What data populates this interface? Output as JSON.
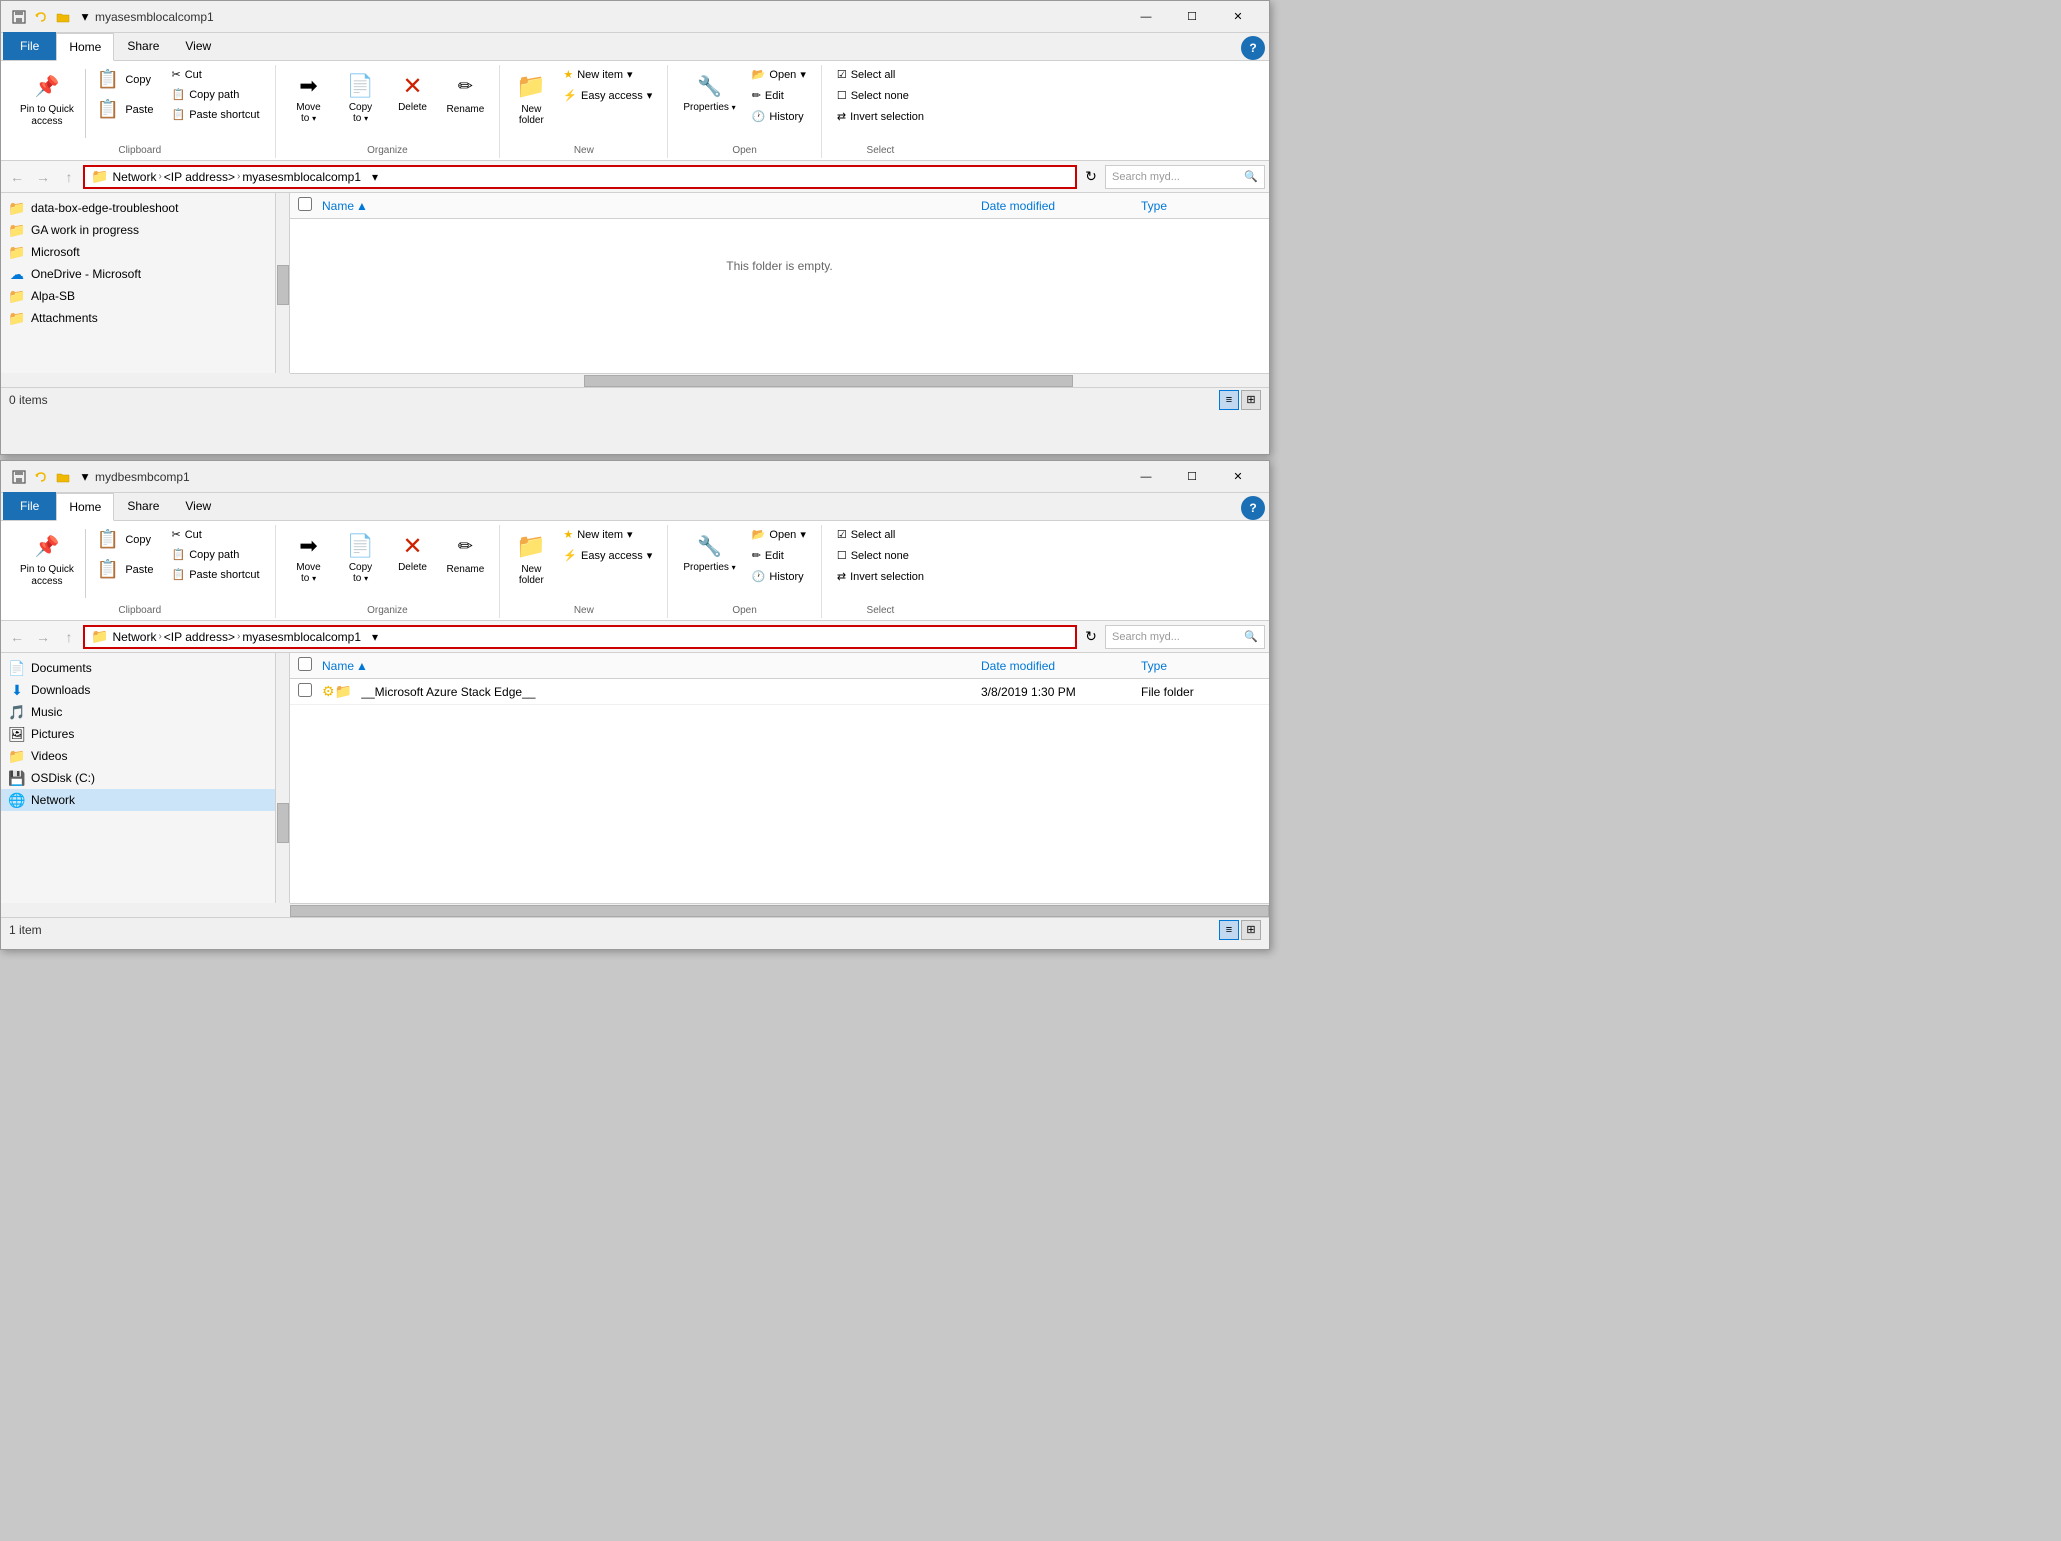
{
  "window1": {
    "title": "myasesmblocalcomp1",
    "tabs": {
      "file": "File",
      "home": "Home",
      "share": "Share",
      "view": "View"
    },
    "ribbon": {
      "clipboard": {
        "label": "Clipboard",
        "pin_to_quick_access": "Pin to Quick\naccess",
        "copy": "Copy",
        "paste": "Paste",
        "cut": "Cut",
        "copy_path": "Copy path",
        "paste_shortcut": "Paste shortcut"
      },
      "organize": {
        "label": "Organize",
        "move_to": "Move\nto",
        "copy_to": "Copy\nto",
        "delete": "Delete",
        "rename": "Rename"
      },
      "new": {
        "label": "New",
        "new_folder": "New\nfolder",
        "new_item": "New item",
        "easy_access": "Easy access"
      },
      "open": {
        "label": "Open",
        "properties": "Properties",
        "open": "Open",
        "edit": "Edit",
        "history": "History"
      },
      "select": {
        "label": "Select",
        "select_all": "Select all",
        "select_none": "Select none",
        "invert_selection": "Invert selection"
      }
    },
    "address": {
      "path": "Network > <IP address> > myasesmblocalcomp1",
      "network": "Network",
      "ip": "<IP address>",
      "share": "myasesmblocalcomp1",
      "search_placeholder": "Search myd..."
    },
    "nav_items": [
      {
        "label": "data-box-edge-troubleshoot",
        "type": "folder_yellow"
      },
      {
        "label": "GA work in progress",
        "type": "folder_yellow"
      },
      {
        "label": "Microsoft",
        "type": "folder_blue"
      },
      {
        "label": "OneDrive - Microsoft",
        "type": "onedrive"
      },
      {
        "label": "Alpa-SB",
        "type": "folder_yellow"
      },
      {
        "label": "Attachments",
        "type": "folder_yellow"
      }
    ],
    "file_list": {
      "columns": {
        "name": "Name",
        "date_modified": "Date modified",
        "type": "Type"
      },
      "empty_message": "This folder is empty.",
      "items": []
    },
    "status": "0 items"
  },
  "window2": {
    "title": "mydbesmbcomp1",
    "tabs": {
      "file": "File",
      "home": "Home",
      "share": "Share",
      "view": "View"
    },
    "ribbon": {
      "clipboard": {
        "label": "Clipboard",
        "pin_to_quick_access": "Pin to Quick\naccess",
        "copy": "Copy",
        "paste": "Paste",
        "cut": "Cut",
        "copy_path": "Copy path",
        "paste_shortcut": "Paste shortcut"
      },
      "organize": {
        "label": "Organize",
        "move_to": "Move\nto",
        "copy_to": "Copy\nto",
        "delete": "Delete",
        "rename": "Rename"
      },
      "new": {
        "label": "New",
        "new_folder": "New\nfolder",
        "new_item": "New item",
        "easy_access": "Easy access"
      },
      "open": {
        "label": "Open",
        "properties": "Properties",
        "open": "Open",
        "edit": "Edit",
        "history": "History"
      },
      "select": {
        "label": "Select",
        "select_all": "Select all",
        "select_none": "Select none",
        "invert_selection": "Invert selection"
      }
    },
    "address": {
      "path": "Network > <IP address> > myasesmblocalcomp1",
      "network": "Network",
      "ip": "<IP address>",
      "share": "myasesmblocalcomp1",
      "search_placeholder": "Search myd..."
    },
    "nav_items": [
      {
        "label": "Documents",
        "type": "doc"
      },
      {
        "label": "Downloads",
        "type": "download"
      },
      {
        "label": "Music",
        "type": "music"
      },
      {
        "label": "Pictures",
        "type": "pictures"
      },
      {
        "label": "Videos",
        "type": "videos"
      },
      {
        "label": "OSDisk (C:)",
        "type": "disk"
      },
      {
        "label": "Network",
        "type": "network",
        "selected": true
      }
    ],
    "file_list": {
      "columns": {
        "name": "Name",
        "date_modified": "Date modified",
        "type": "Type"
      },
      "items": [
        {
          "name": "__Microsoft Azure Stack Edge__",
          "date_modified": "3/8/2019 1:30 PM",
          "type": "File folder"
        }
      ]
    },
    "status": "1 item"
  }
}
